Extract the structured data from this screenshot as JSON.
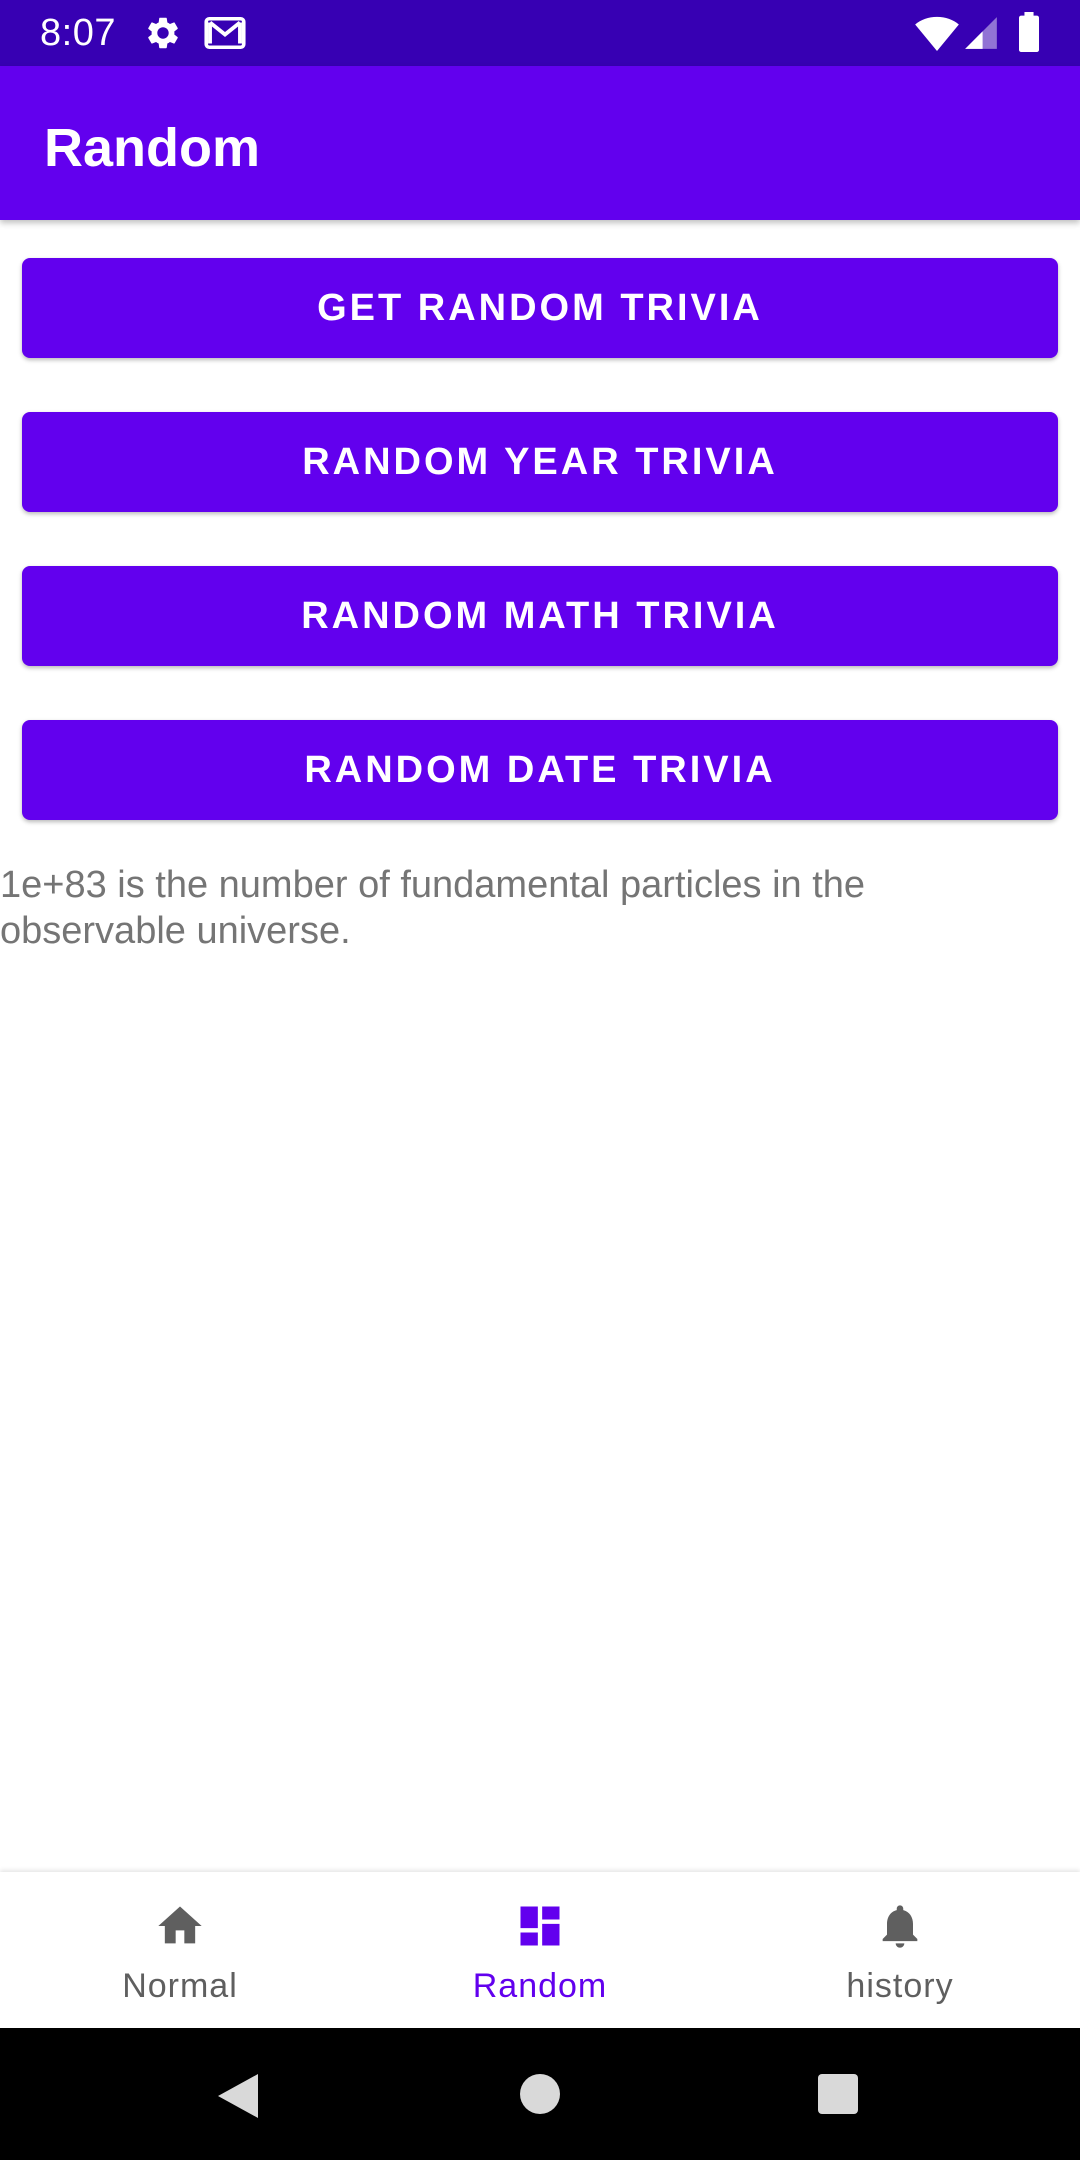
{
  "status_bar": {
    "time": "8:07",
    "icons": [
      "gear-icon",
      "gmail-icon",
      "wifi-icon",
      "signal-icon",
      "battery-icon"
    ]
  },
  "app_bar": {
    "title": "Random"
  },
  "buttons": {
    "get_random": "GET RANDOM TRIVIA",
    "random_year": "RANDOM YEAR TRIVIA",
    "random_math": "RANDOM MATH TRIVIA",
    "random_date": "RANDOM DATE TRIVIA"
  },
  "trivia": {
    "text": "1e+83 is the number of fundamental particles in the observable universe."
  },
  "bottom_nav": {
    "items": [
      {
        "label": "Normal",
        "icon": "home-icon",
        "active": false
      },
      {
        "label": "Random",
        "icon": "dashboard-icon",
        "active": true
      },
      {
        "label": "history",
        "icon": "bell-icon",
        "active": false
      }
    ]
  },
  "system_nav": {
    "icons": [
      "back-icon",
      "home-circle-icon",
      "recents-icon"
    ]
  },
  "colors": {
    "status_bar": "#3700B3",
    "primary": "#6200EE",
    "text_secondary": "#757575",
    "nav_inactive": "#5F5F5F"
  }
}
